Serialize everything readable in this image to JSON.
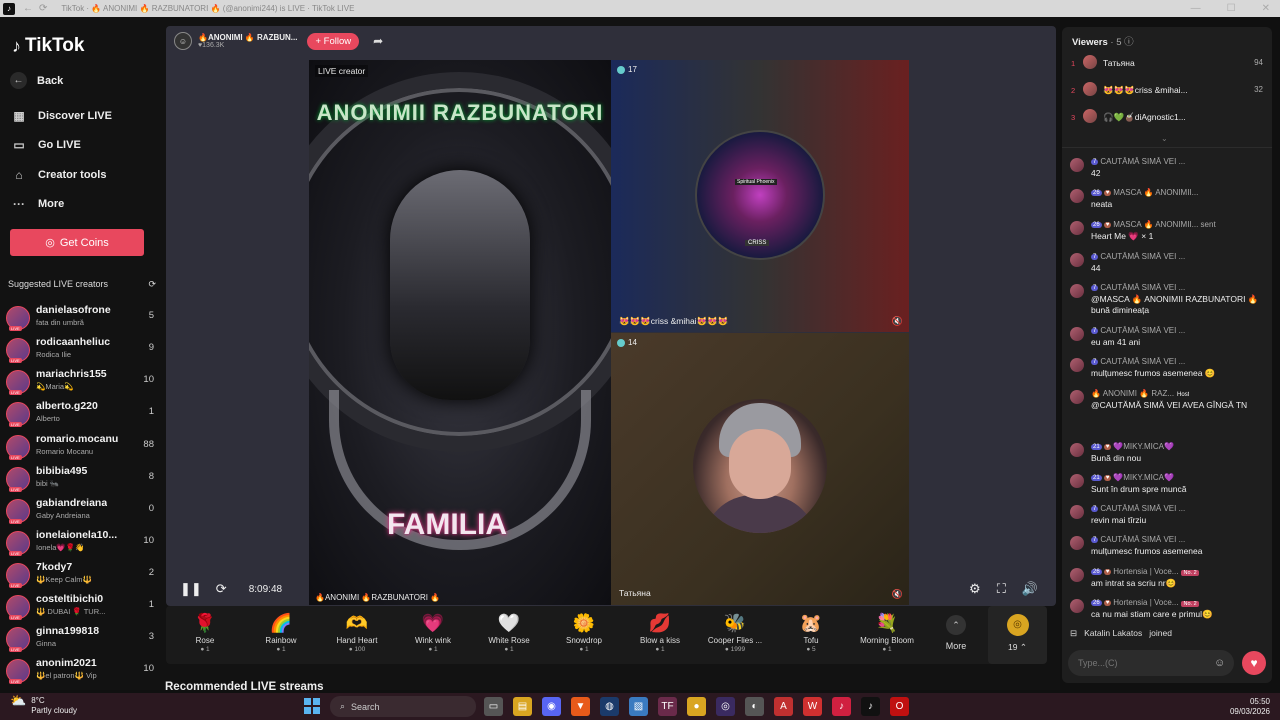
{
  "browser": {
    "title": "TikTok · 🔥 ANONIMI 🔥 RAZBUNATORI 🔥 (@anonimi244) is LIVE · TikTok LIVE"
  },
  "sidebar": {
    "logo": "TikTok",
    "nav": [
      {
        "label": "Back",
        "icon": "back-arrow-icon"
      },
      {
        "label": "Discover LIVE",
        "icon": "discover-icon"
      },
      {
        "label": "Go LIVE",
        "icon": "camera-icon"
      },
      {
        "label": "Creator tools",
        "icon": "creator-tools-icon"
      },
      {
        "label": "More",
        "icon": "more-icon"
      }
    ],
    "coins_button": "Get Coins",
    "suggested_title": "Suggested LIVE creators",
    "creators": [
      {
        "name": "danielasofrone",
        "sub": "fata din umbră",
        "count": "5"
      },
      {
        "name": "rodicaanheliuc",
        "sub": "Rodica Ilie",
        "count": "9"
      },
      {
        "name": "mariachris155",
        "sub": "💫Maria💫",
        "count": "10"
      },
      {
        "name": "alberto.g220",
        "sub": "Alberto",
        "count": "1"
      },
      {
        "name": "romario.mocanu",
        "sub": "Romario Mocanu",
        "count": "88"
      },
      {
        "name": "bibibia495",
        "sub": "bibi 🐜",
        "count": "8"
      },
      {
        "name": "gabiandreiana",
        "sub": "Gaby Andreiana",
        "count": "0"
      },
      {
        "name": "ionelaionela10...",
        "sub": "Ionela💗🌹👋",
        "count": "10"
      },
      {
        "name": "7kody7",
        "sub": "🔱Keep Calm🔱",
        "count": "2"
      },
      {
        "name": "costeltibichi0",
        "sub": "🔱 DUBAI 🌹 TUR...",
        "count": "1"
      },
      {
        "name": "ginna199818",
        "sub": "Ginna",
        "count": "3"
      },
      {
        "name": "anonim2021",
        "sub": "🔱el patron🔱 Vip",
        "count": "10"
      }
    ]
  },
  "stream": {
    "host_name": "🔥ANONIMI 🔥 RAZBUN...",
    "host_likes": "♥136.3K",
    "follow_label": "+ Follow",
    "main_tag": "LIVE creator",
    "main_banner": "ANONIMII RAZBUNATORI",
    "main_word": "FAMILIA",
    "main_footer": "🔥ANONIMI 🔥RAZBUNATORI 🔥",
    "guest1_count": "17",
    "guest1_logo_top": "Spiritual Phoenix",
    "guest1_logo_bottom": "CRISS",
    "guest1_name": "😻😻😻criss &mihai😻😻😻",
    "guest2_count": "14",
    "guest2_name": "Татьяна",
    "elapsed": "8:09:48"
  },
  "gifts": [
    {
      "name": "Rose",
      "price": "1",
      "icon": "🌹"
    },
    {
      "name": "Rainbow",
      "price": "1",
      "icon": "🌈"
    },
    {
      "name": "Hand Heart",
      "price": "100",
      "icon": "🫶"
    },
    {
      "name": "Wink wink",
      "price": "1",
      "icon": "💗"
    },
    {
      "name": "White Rose",
      "price": "1",
      "icon": "🤍"
    },
    {
      "name": "Snowdrop",
      "price": "1",
      "icon": "🌼"
    },
    {
      "name": "Blow a kiss",
      "price": "1",
      "icon": "💋"
    },
    {
      "name": "Cooper Flies ...",
      "price": "1999",
      "icon": "🐝"
    },
    {
      "name": "Tofu",
      "price": "5",
      "icon": "🐹"
    },
    {
      "name": "Morning Bloom",
      "price": "1",
      "icon": "💐"
    }
  ],
  "gifts_more": "More",
  "coin_balance": "19",
  "recommended_title": "Recommended LIVE streams",
  "chat": {
    "viewers_title": "Viewers",
    "viewers_count": "· 5",
    "top_viewers": [
      {
        "rank": "1",
        "name": "Татьяна",
        "score": "94"
      },
      {
        "rank": "2",
        "name": "😻😻😻criss &mihai...",
        "score": "32"
      },
      {
        "rank": "3",
        "name": "🎧💚🧉diAgnostic1...",
        "score": ""
      }
    ],
    "messages": [
      {
        "level": "7",
        "user": "CAUTĂMĂ SIMĂ VEI ...",
        "text": "42"
      },
      {
        "level": "26",
        "user": "MASCA 🔥 ANONIMII...",
        "text": "neata"
      },
      {
        "level": "26",
        "user": "MASCA 🔥 ANONIMII... sent",
        "text": "Heart Me 💗 × 1"
      },
      {
        "level": "7",
        "user": "CAUTĂMĂ SIMĂ VEI ...",
        "text": "44"
      },
      {
        "level": "7",
        "user": "CAUTĂMĂ SIMĂ VEI ...",
        "text": "@MASCA 🔥 ANONIMII RAZBUNATORI 🔥 bună dimineața"
      },
      {
        "level": "7",
        "user": "CAUTĂMĂ SIMĂ VEI ...",
        "text": "eu am 41 ani"
      },
      {
        "level": "7",
        "user": "CAUTĂMĂ SIMĂ VEI ...",
        "text": "mulțumesc frumos asemenea 😊"
      },
      {
        "level": "",
        "user": "🔥 ANONIMI 🔥 RAZ...",
        "host": "Host",
        "text": "@CAUTĂMĂ SIMĂ VEI AVEA GÎNGĂ TN"
      },
      {
        "level": "21",
        "user": "💜MIKY.MICA💜",
        "text": "Bună din nou"
      },
      {
        "level": "21",
        "user": "💜MIKY.MICA💜",
        "text": "Sunt în drum spre muncă"
      },
      {
        "level": "7",
        "user": "CAUTĂMĂ SIMĂ VEI ...",
        "text": "revin mai tîrziu"
      },
      {
        "level": "7",
        "user": "CAUTĂMĂ SIMĂ VEI ...",
        "text": "mulțumesc frumos asemenea"
      },
      {
        "level": "26",
        "user": "Hortensia | Voce...",
        "nbadge": "No. 2",
        "text": "am intrat sa scriu nr😊"
      },
      {
        "level": "26",
        "user": "Hortensia | Voce...",
        "nbadge": "No. 2",
        "text": "ca nu mai stiam care e primul😊"
      }
    ],
    "joined_user": "Katalin Lakatos",
    "joined_text": "joined",
    "input_placeholder": "Type...(C)"
  },
  "taskbar": {
    "temp": "8°C",
    "weather": "Partly cloudy",
    "search": "Search",
    "time": "05:50",
    "date": "09/03/2026"
  }
}
